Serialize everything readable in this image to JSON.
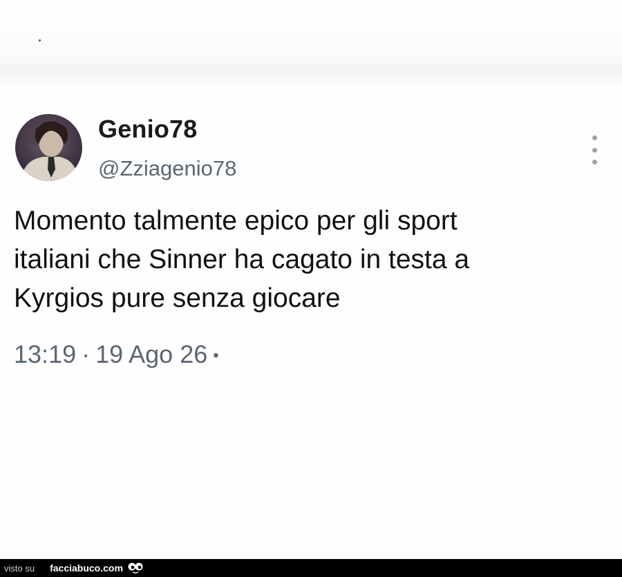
{
  "tweet": {
    "display_name": "Genio78",
    "handle": "@Zziagenio78",
    "text_lines": [
      "Momento talmente epico per gli sport",
      "italiani che Sinner ha cagato in testa a",
      "Kyrgios pure senza giocare"
    ],
    "time": "13:19",
    "separator": "·",
    "date": "19 Ago 26",
    "trailing_dot": "•",
    "more_icon": "more-vertical-icon"
  },
  "watermark": {
    "visto_label": "visto su",
    "site_label": "facciabuco.com",
    "logo_icon": "eyes-logo-icon",
    "bar_color": "#000000"
  },
  "colors": {
    "text": "#111111",
    "secondary": "#5b6670",
    "background": "#ffffff"
  }
}
